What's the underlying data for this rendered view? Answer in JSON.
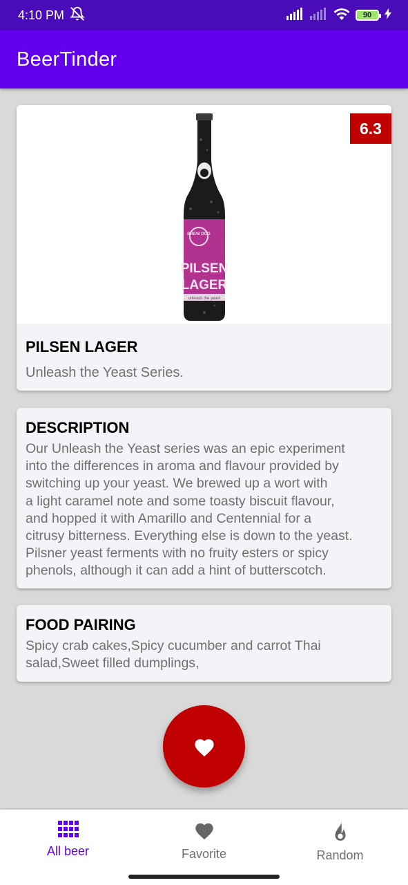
{
  "status_bar": {
    "time": "4:10 PM",
    "battery": "90",
    "icons": [
      "alarm-off-icon",
      "signal-icon",
      "signal-off-icon",
      "wifi-icon",
      "battery-icon",
      "charging-icon"
    ]
  },
  "app_bar": {
    "title": "BeerTinder"
  },
  "beer": {
    "abv": "6.3",
    "name": "PILSEN LAGER",
    "tagline": "Unleash the Yeast Series.",
    "label_top": "BREW DOG",
    "label_main_1": "PILSEN",
    "label_main_2": "LAGER",
    "label_bottom": "unleash the yeast"
  },
  "description": {
    "title": "DESCRIPTION",
    "lines": [
      "Our Unleash the Yeast series was an epic experiment",
      "into the differences in aroma and flavour provided by",
      "switching up your yeast. We brewed up a wort with",
      "a light caramel note and some toasty biscuit flavour,",
      "and hopped it with Amarillo and Centennial for a",
      "citrusy bitterness. Everything else is down to the yeast.",
      "Pilsner yeast ferments with no fruity esters or spicy",
      "phenols, although it can add a hint of butterscotch."
    ]
  },
  "food_pairing": {
    "title": "FOOD PAIRING",
    "lines": [
      "Spicy crab cakes,Spicy cucumber and carrot Thai",
      "salad,Sweet filled dumplings,"
    ]
  },
  "fab": {
    "icon": "heart-icon",
    "color": "#c00000"
  },
  "bottom_nav": {
    "items": [
      {
        "label": "All beer",
        "icon": "grid-icon",
        "active": true
      },
      {
        "label": "Favorite",
        "icon": "heart-icon",
        "active": false
      },
      {
        "label": "Random",
        "icon": "flame-icon",
        "active": false
      }
    ]
  },
  "colors": {
    "status_bar": "#4a0bb8",
    "app_bar": "#6200ee",
    "accent": "#c00000",
    "background": "#d9d9d9"
  }
}
